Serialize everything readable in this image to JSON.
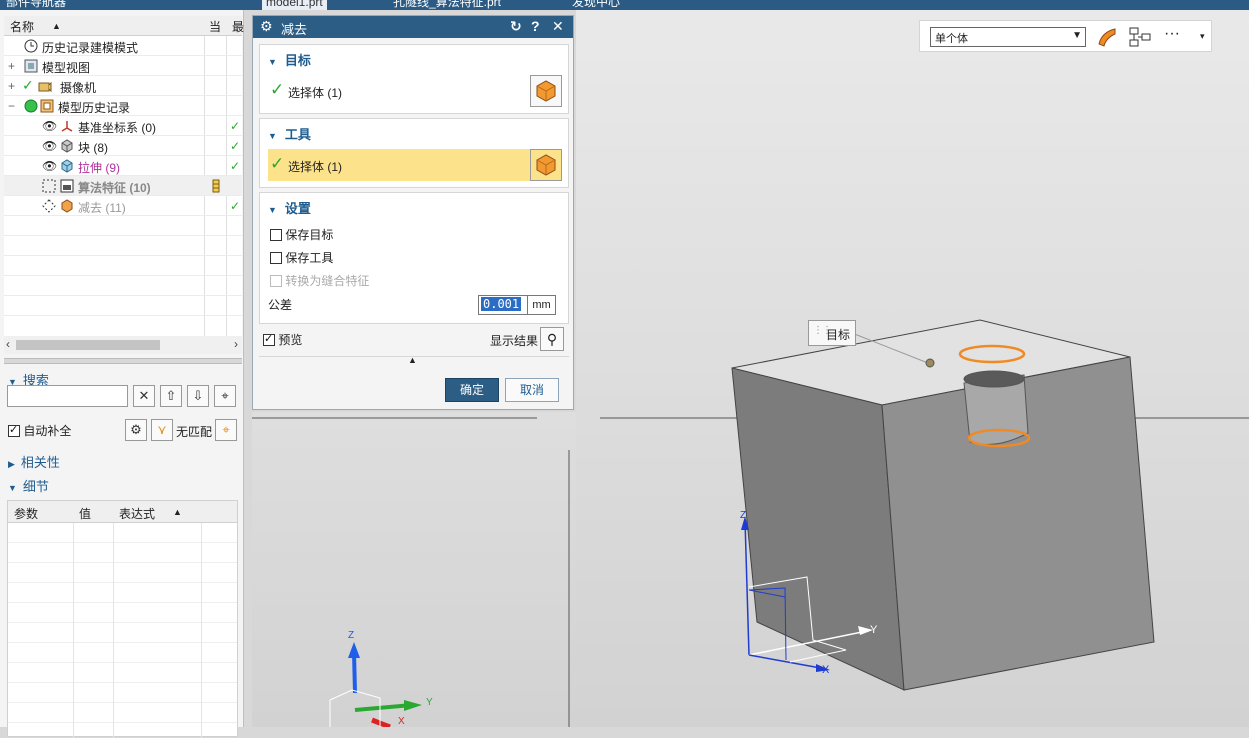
{
  "tabs": [
    {
      "label": "部件导航器"
    },
    {
      "label": "model1.prt"
    },
    {
      "label": "孔隧线_算法特征.prt"
    },
    {
      "label": "发现中心"
    }
  ],
  "navigator": {
    "columns": {
      "name": "名称",
      "current": "当",
      "last": "最"
    },
    "tree": [
      {
        "label": "历史记录建模模式",
        "icon": "clock-icon",
        "check": ""
      },
      {
        "label": "模型视图",
        "icon": "view-icon",
        "check": ""
      },
      {
        "label": "摄像机",
        "icon": "camera-icon",
        "check": ""
      },
      {
        "label": "模型历史记录",
        "icon": "history-icon",
        "check": ""
      },
      {
        "label": "基准坐标系 (0)",
        "icon": "datum-csys-icon",
        "check": "✓"
      },
      {
        "label": "块 (8)",
        "icon": "block-icon",
        "check": "✓"
      },
      {
        "label": "拉伸 (9)",
        "icon": "extrude-icon",
        "check": "✓"
      },
      {
        "label": "算法特征 (10)",
        "icon": "algorithm-icon",
        "check": ""
      },
      {
        "label": "减去 (11)",
        "icon": "subtract-icon",
        "check": "✓"
      }
    ],
    "search": {
      "title": "搜索",
      "input": "",
      "auto_complete": "自动补全",
      "no_match": "无匹配"
    },
    "relevance": {
      "title": "相关性"
    },
    "detail": {
      "title": "细节",
      "columns": [
        "参数",
        "值",
        "表达式"
      ]
    }
  },
  "dialog": {
    "title": "减去",
    "target": {
      "title": "目标",
      "select": "选择体 (1)"
    },
    "tool": {
      "title": "工具",
      "select": "选择体 (1)"
    },
    "settings": {
      "title": "设置",
      "keep_target": "保存目标",
      "keep_tool": "保存工具",
      "convert": "转换为缝合特征",
      "tolerance_label": "公差",
      "tolerance_value": "0.001",
      "unit": "mm"
    },
    "preview": "预览",
    "show_result": "显示结果",
    "ok": "确定",
    "cancel": "取消"
  },
  "viewport": {
    "selection_filter": "单个体",
    "callout": "目标",
    "axes": {
      "z": "Z",
      "y": "Y",
      "x": "X"
    }
  },
  "colors": {
    "title_bar": "#2c5d85",
    "highlight": "#fce28a",
    "accent_orange": "#f0a030",
    "check_green": "#2aa832"
  }
}
